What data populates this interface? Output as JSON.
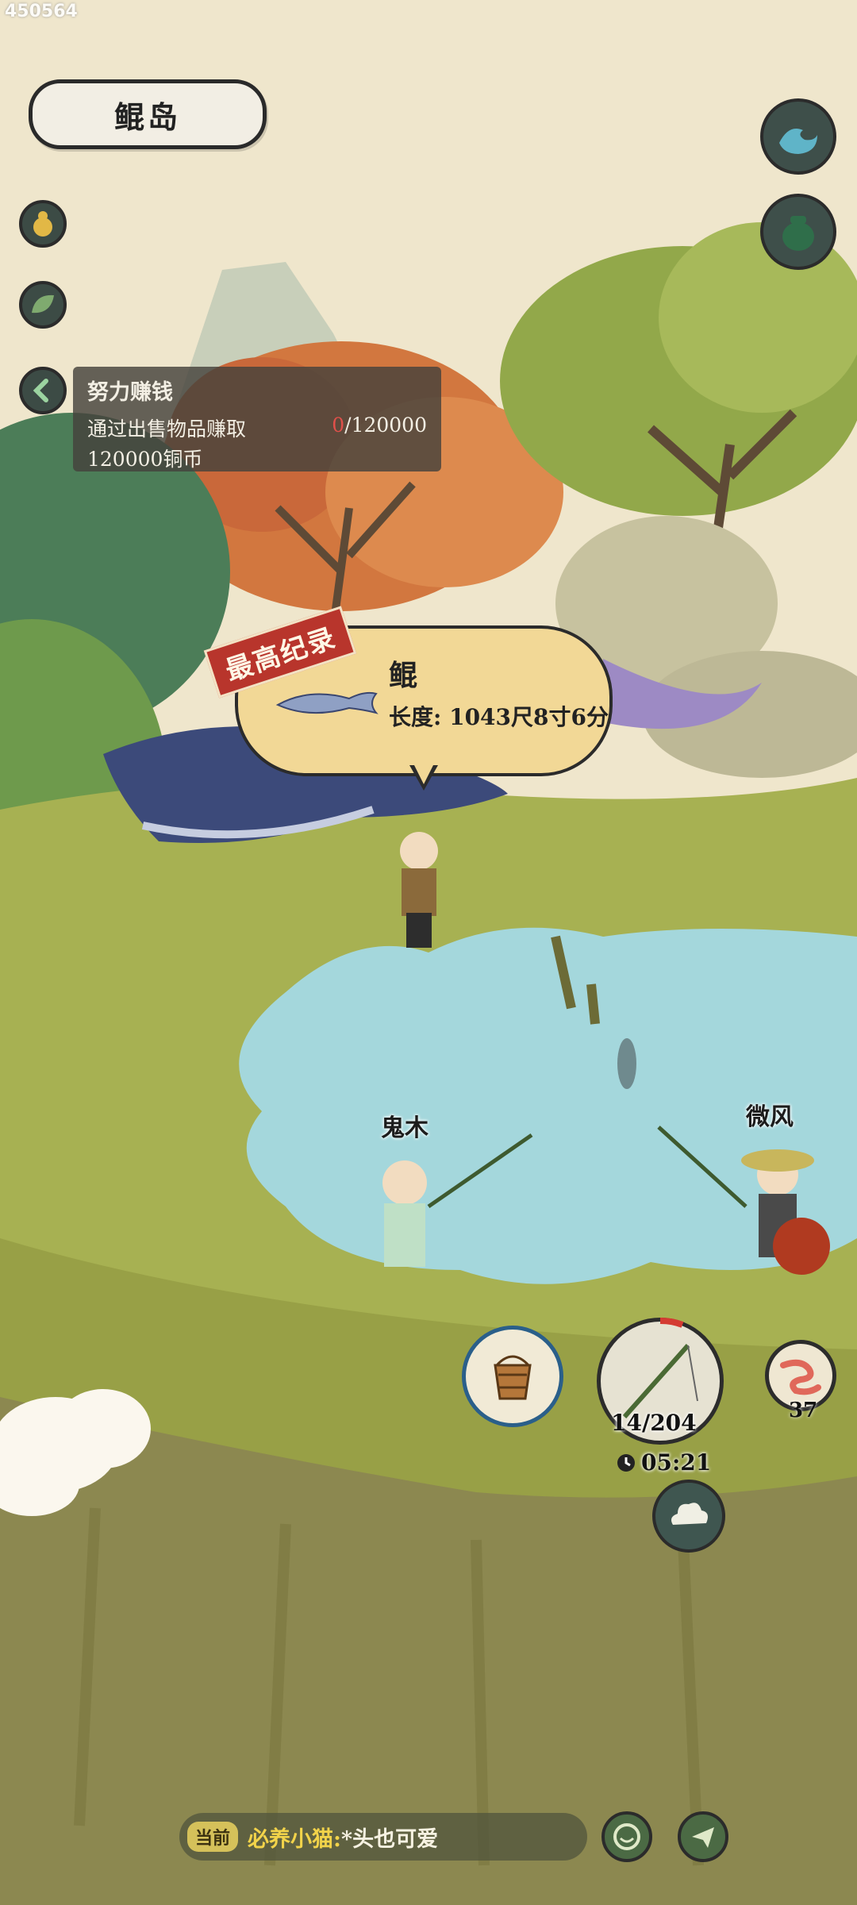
{
  "watermark": "450564",
  "location": {
    "name": "鲲岛"
  },
  "task": {
    "title": "努力赚钱",
    "desc_line1": "通过出售物品赚取",
    "progress_current": "0",
    "progress_total": "/120000",
    "desc_line2": "120000铜币"
  },
  "record": {
    "tag": "最高纪录",
    "fish_name": "鲲",
    "length": "长度: 1043尺8寸6分"
  },
  "players": {
    "left_name": "鬼木",
    "right_name": "微风"
  },
  "fishing": {
    "rod_count": "14/204",
    "timer": "05:21",
    "bait_count": "37"
  },
  "chat": {
    "channel": "当前",
    "user": "必养小猫:",
    "message": "*头也可爱"
  },
  "icons": {
    "wave": "wave-icon",
    "pot": "pot-icon",
    "gourd": "gourd-icon",
    "leaf": "leaf-icon",
    "back": "chevron-left-icon",
    "bucket": "bucket-icon",
    "rod": "fishing-rod-icon",
    "worm": "worm-icon",
    "cloud": "cloud-icon",
    "emoji": "emoji-icon",
    "send": "send-icon",
    "clock": "clock-icon"
  }
}
